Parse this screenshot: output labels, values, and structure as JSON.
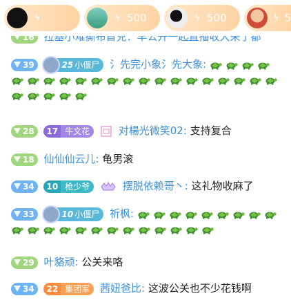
{
  "top_bar": {
    "pills": [
      {
        "value": ""
      },
      {
        "value": "500"
      },
      {
        "value": "500"
      },
      {
        "value": "5"
      }
    ]
  },
  "messages": [
    {
      "level": "16",
      "text": "拉基小难撕布首兑：早公开一起直播收大来了都"
    },
    {
      "level": "39",
      "guard_level": "25",
      "guard_name": "小僵尸",
      "nick": "氵先完小象氵先大象:",
      "turtles": 26
    },
    {
      "level": "28",
      "fan_level": "17",
      "fan_name": "牛文花",
      "nick": "对楊光微笑02:",
      "text": "支持复合"
    },
    {
      "level": "18",
      "nick": "仙仙仙云儿:",
      "text": "龟男滚"
    },
    {
      "level": "34",
      "fan_level": "10",
      "fan_name": "枪少爷",
      "nick": "摆脱依赖哥丶:",
      "text": "这礼物收麻了"
    },
    {
      "level": "33",
      "guard_level": "10",
      "guard_name": "小僵尸",
      "nick": "祈枫:",
      "turtles": 22
    },
    {
      "level": "29",
      "nick": "叶貉顽:",
      "text": "公关来咯"
    },
    {
      "level": "34",
      "fan_level": "22",
      "fan_name": "集团军",
      "nick": "茜妞爸比:",
      "text": "这波公关也不少花钱啊"
    }
  ]
}
